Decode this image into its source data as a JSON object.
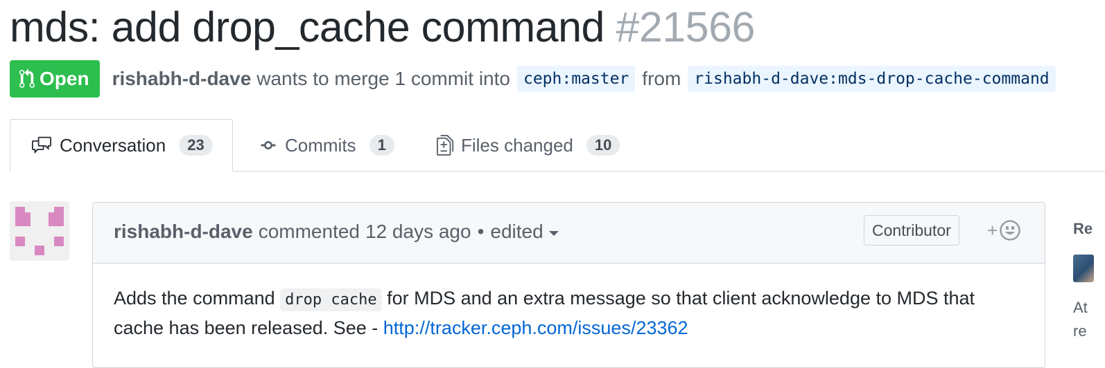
{
  "pr": {
    "title": "mds: add drop_cache command",
    "number": "#21566",
    "state": "Open",
    "author": "rishabh-d-dave",
    "merge_text": "wants to merge 1 commit into",
    "base_branch": "ceph:master",
    "from_text": "from",
    "head_branch": "rishabh-d-dave:mds-drop-cache-command",
    "state_color": "#2cbe4e"
  },
  "tabs": [
    {
      "label": "Conversation",
      "count": "23",
      "icon": "comment-discussion-icon",
      "selected": true
    },
    {
      "label": "Commits",
      "count": "1",
      "icon": "git-commit-icon",
      "selected": false
    },
    {
      "label": "Files changed",
      "count": "10",
      "icon": "diff-icon",
      "selected": false
    }
  ],
  "comment": {
    "author": "rishabh-d-dave",
    "action": "commented",
    "time": "12 days ago",
    "separator": "•",
    "edited": "edited",
    "role": "Contributor",
    "reaction_plus": "+",
    "body_before_code": "Adds the command",
    "code": "drop cache",
    "body_after_code": "for MDS and an extra message so that client acknowledge to MDS that cache has been released. See -",
    "link": "http://tracker.ceph.com/issues/23362"
  },
  "sidebar": {
    "heading": "Re",
    "line1": "At",
    "line2": "re"
  }
}
